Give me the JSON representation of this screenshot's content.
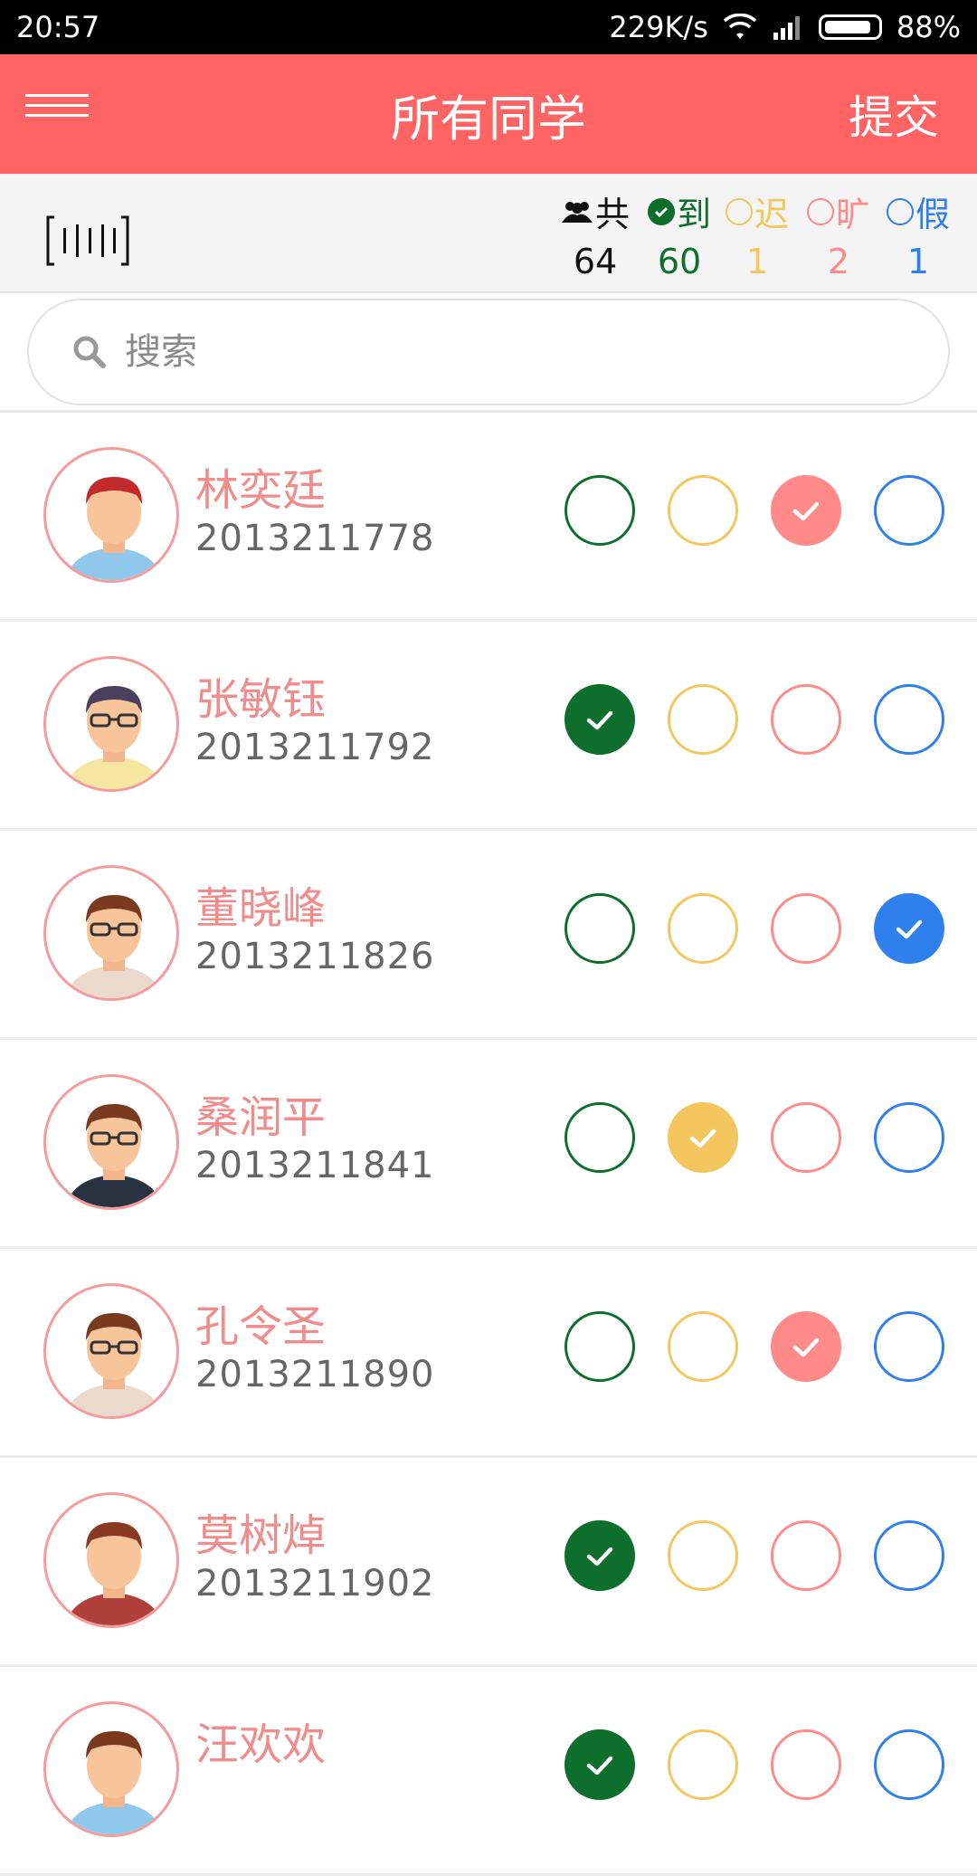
{
  "status_bar": {
    "time": "20:57",
    "speed": "229K/s",
    "battery": "88%"
  },
  "header": {
    "title": "所有同学",
    "submit_label": "提交"
  },
  "summary": {
    "total_label": "共",
    "total": "64",
    "present_label": "到",
    "present": "60",
    "late_label": "迟",
    "late": "1",
    "absent_label": "旷",
    "absent": "2",
    "leave_label": "假",
    "leave": "1"
  },
  "search": {
    "placeholder": "搜索"
  },
  "colors": {
    "accent": "#ff6465",
    "present": "#0e6e2c",
    "late": "#f4c65e",
    "absent": "#ff8a8a",
    "leave": "#2f80ed"
  },
  "students": [
    {
      "name": "林奕廷",
      "id": "2013211778",
      "status": "absent"
    },
    {
      "name": "张敏钰",
      "id": "2013211792",
      "status": "present"
    },
    {
      "name": "董晓峰",
      "id": "2013211826",
      "status": "leave"
    },
    {
      "name": "桑润平",
      "id": "2013211841",
      "status": "late"
    },
    {
      "name": "孔令圣",
      "id": "2013211890",
      "status": "absent"
    },
    {
      "name": "莫树焯",
      "id": "2013211902",
      "status": "present"
    },
    {
      "name": "汪欢欢",
      "id": "",
      "status": "present"
    }
  ]
}
